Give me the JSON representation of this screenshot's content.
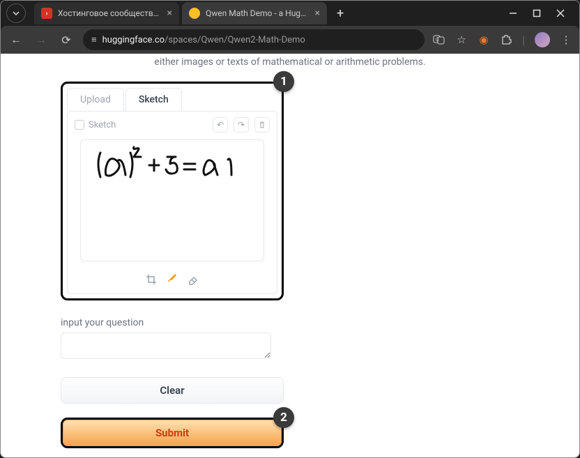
{
  "browser": {
    "tabs": [
      {
        "title": "Хостинговое сообщество «Tim",
        "favcolor": "#d93025"
      },
      {
        "title": "Qwen Math Demo - a Hugging",
        "favcolor": "#fbbf24"
      }
    ],
    "url_domain": "huggingface.co",
    "url_path": "/spaces/Qwen/Qwen2-Math-Demo"
  },
  "page": {
    "intro_fragment": "either images or texts of mathematical or arithmetic problems.",
    "tabs": {
      "upload": "Upload",
      "sketch": "Sketch"
    },
    "sketch_label": "Sketch",
    "question_label": "input your question",
    "question_value": "",
    "clear_label": "Clear",
    "submit_label": "Submit"
  },
  "annotations": {
    "badge1": "1",
    "badge2": "2"
  }
}
